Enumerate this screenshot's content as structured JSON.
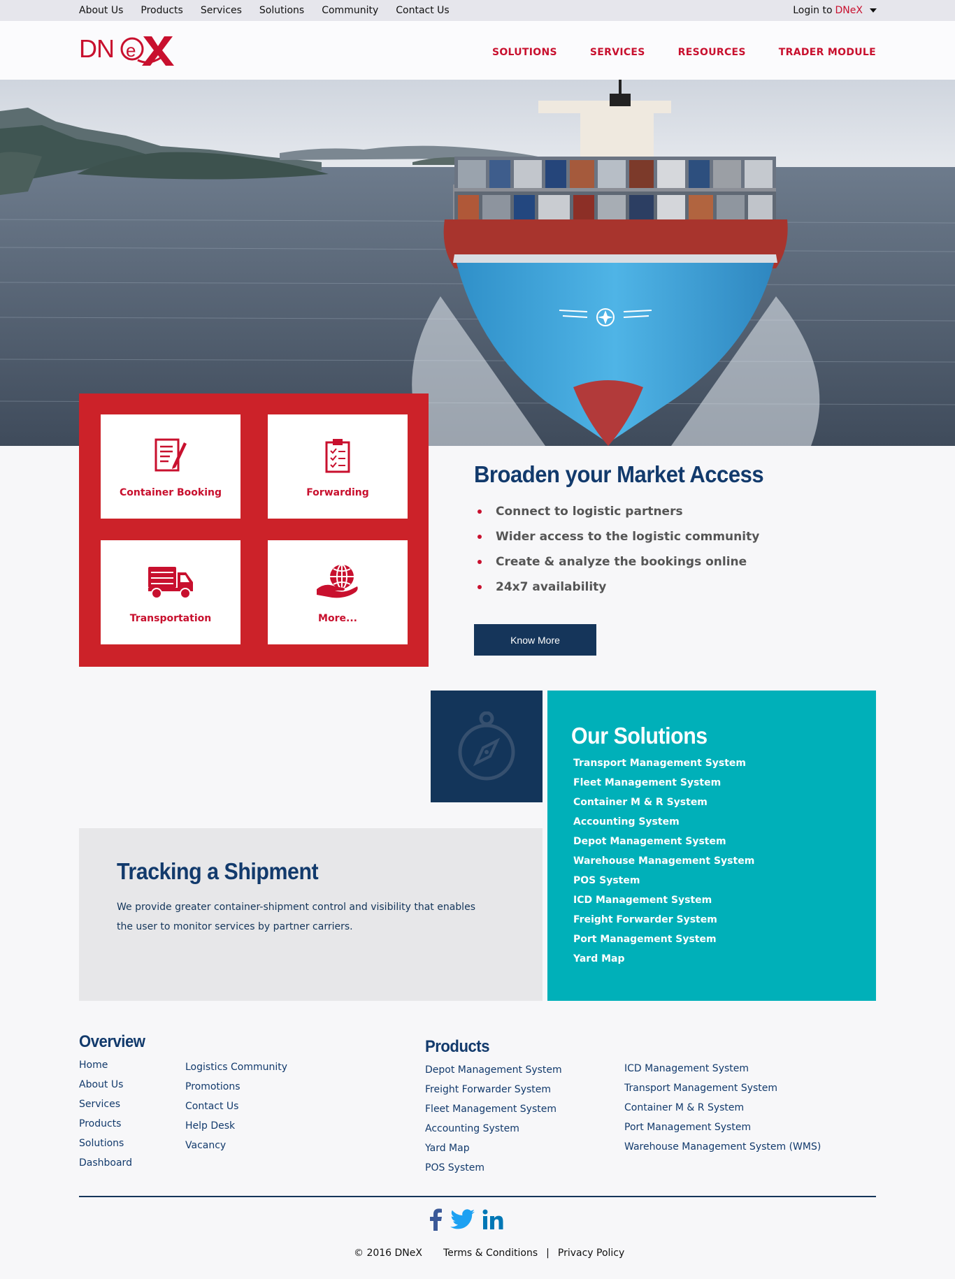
{
  "topbar": {
    "links": [
      "About Us",
      "Products",
      "Services",
      "Solutions",
      "Community",
      "Contact Us"
    ],
    "login_text": "Login to",
    "login_brand": "DNeX"
  },
  "header": {
    "logo_text": "DNeX",
    "nav": [
      "SOLUTIONS",
      "SERVICES",
      "RESOURCES",
      "TRADER MODULE"
    ]
  },
  "tiles": [
    {
      "label": "Container Booking",
      "icon": "booking-icon"
    },
    {
      "label": "Forwarding",
      "icon": "clipboard-icon"
    },
    {
      "label": "Transportation",
      "icon": "truck-icon"
    },
    {
      "label": "More...",
      "icon": "globe-hand-icon"
    }
  ],
  "market": {
    "title": "Broaden your Market Access",
    "bullets": [
      "Connect to logistic partners",
      "Wider access to the logistic community",
      "Create & analyze the bookings online",
      "24x7 availability"
    ],
    "button": "Know More"
  },
  "solutions": {
    "title": "Our Solutions",
    "items": [
      "Transport Management System",
      "Fleet Management System",
      "Container M & R System",
      "Accounting System",
      "Depot Management System",
      "Warehouse Management System",
      "POS System",
      "ICD Management System",
      "Freight Forwarder System",
      "Port Management System",
      "Yard Map"
    ]
  },
  "tracking": {
    "title": "Tracking a Shipment",
    "text": "We provide greater container-shipment control and visibility that enables the user to monitor services by partner carriers."
  },
  "footer": {
    "overview_title": "Overview",
    "overview_col1": [
      "Home",
      "About Us",
      "Services",
      "Products",
      "Solutions",
      "Dashboard"
    ],
    "overview_col2": [
      "Logistics Community",
      "Promotions",
      "Contact Us",
      "Help Desk",
      "Vacancy"
    ],
    "products_title": "Products",
    "products_col1": [
      "Depot Management System",
      "Freight Forwarder System",
      "Fleet Management System",
      "Accounting System",
      "Yard Map",
      "POS System"
    ],
    "products_col2": [
      "ICD Management System",
      "Transport Management System",
      "Container M & R System",
      "Port Management System",
      "Warehouse Management System (WMS)"
    ],
    "copyright": "© 2016 DNeX",
    "terms": "Terms & Conditions",
    "separator": "|",
    "privacy": "Privacy Policy",
    "social_icons": [
      "facebook-icon",
      "twitter-icon",
      "linkedin-icon"
    ]
  },
  "colors": {
    "brand_red": "#c8102e",
    "navy": "#15355a",
    "teal": "#00b0b9"
  }
}
